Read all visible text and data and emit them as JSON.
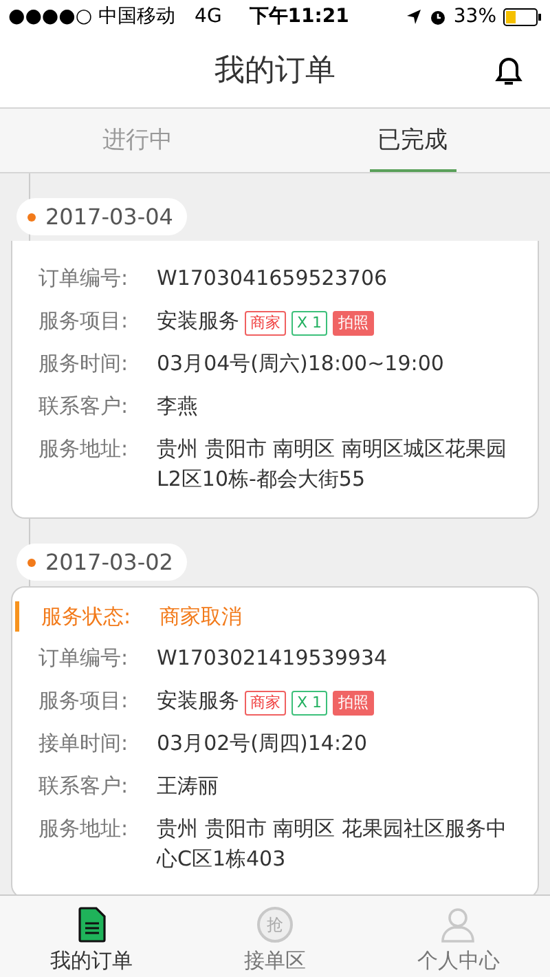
{
  "status_bar": {
    "carrier": "●●●●○ 中国移动",
    "network": "4G",
    "time": "下午11:21",
    "battery": "33%"
  },
  "header": {
    "title": "我的订单"
  },
  "tabs": [
    {
      "label": "进行中",
      "selected": false
    },
    {
      "label": "已完成",
      "selected": true
    }
  ],
  "orders": [
    {
      "date": "2017-03-04",
      "fields": [
        {
          "label": "订单编号:",
          "value": "W1703041659523706"
        },
        {
          "label": "服务项目:",
          "value": "安装服务",
          "tags": [
            {
              "kind": "outline-red",
              "text": "商家"
            },
            {
              "kind": "outline-green",
              "text": "X 1"
            },
            {
              "kind": "filled-red",
              "text": "拍照"
            }
          ]
        },
        {
          "label": "服务时间:",
          "value": "03月04号(周六)18:00~19:00"
        },
        {
          "label": "联系客户:",
          "value": "李燕"
        },
        {
          "label": "服务地址:",
          "value": "贵州 贵阳市 南明区  南明区城区花果园L2区10栋-都会大街55"
        }
      ]
    },
    {
      "date": "2017-03-02",
      "status": {
        "label": "服务状态:",
        "value": "商家取消"
      },
      "fields": [
        {
          "label": "订单编号:",
          "value": "W1703021419539934"
        },
        {
          "label": "服务项目:",
          "value": "安装服务",
          "tags": [
            {
              "kind": "outline-red",
              "text": "商家"
            },
            {
              "kind": "outline-green",
              "text": "X 1"
            },
            {
              "kind": "filled-red",
              "text": "拍照"
            }
          ]
        },
        {
          "label": "接单时间:",
          "value": "03月02号(周四)14:20"
        },
        {
          "label": "联系客户:",
          "value": "王涛丽"
        },
        {
          "label": "服务地址:",
          "value": "贵州 贵阳市 南明区  花果园社区服务中心C区1栋403"
        }
      ]
    }
  ],
  "bottom_nav": [
    {
      "kind": "document",
      "label": "我的订单",
      "selected": true
    },
    {
      "kind": "grab",
      "label": "接单区",
      "icon_text": "抢",
      "selected": false
    },
    {
      "kind": "person",
      "label": "个人中心",
      "selected": false
    }
  ]
}
